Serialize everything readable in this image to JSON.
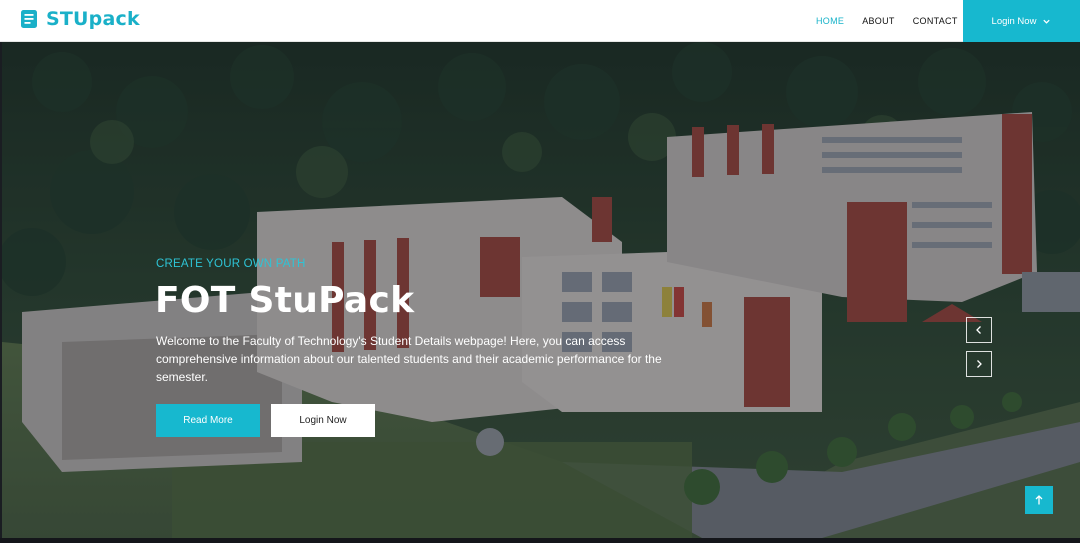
{
  "brand": {
    "name": "STUpack",
    "icon": "book-icon"
  },
  "nav": {
    "items": [
      {
        "label": "HOME",
        "active": true
      },
      {
        "label": "ABOUT",
        "active": false
      },
      {
        "label": "CONTACT",
        "active": false
      }
    ],
    "login_label": "Login Now",
    "login_icon": "chevron-down-icon"
  },
  "hero": {
    "tagline": "CREATE YOUR OWN PATH",
    "title": "FOT StuPack",
    "description": "Welcome to the Faculty of Technology's Student Details webpage! Here, you can access comprehensive information about our talented students and their academic performance for the semester.",
    "primary_button": "Read More",
    "secondary_button": "Login Now",
    "prev_icon": "chevron-left-icon",
    "next_icon": "chevron-right-icon"
  },
  "back_to_top_icon": "arrow-up-icon",
  "colors": {
    "accent": "#17b8cf",
    "nav_active": "#17b3c9",
    "tagline": "#2ec4d6"
  }
}
